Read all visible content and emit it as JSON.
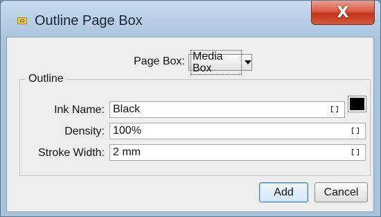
{
  "window": {
    "title": "Outline Page Box",
    "close_symbol": "X"
  },
  "page_box": {
    "label": "Page Box:",
    "selected": "Media Box"
  },
  "outline": {
    "legend": "Outline",
    "ink_name": {
      "label": "Ink Name:",
      "value": "Black",
      "swatch_color": "#000000"
    },
    "density": {
      "label": "Density:",
      "value": "100%"
    },
    "stroke_width": {
      "label": "Stroke Width:",
      "value": "2 mm"
    }
  },
  "buttons": {
    "add": "Add",
    "cancel": "Cancel"
  },
  "colors": {
    "accent": "#3c7fb1",
    "close": "#c2341e"
  }
}
